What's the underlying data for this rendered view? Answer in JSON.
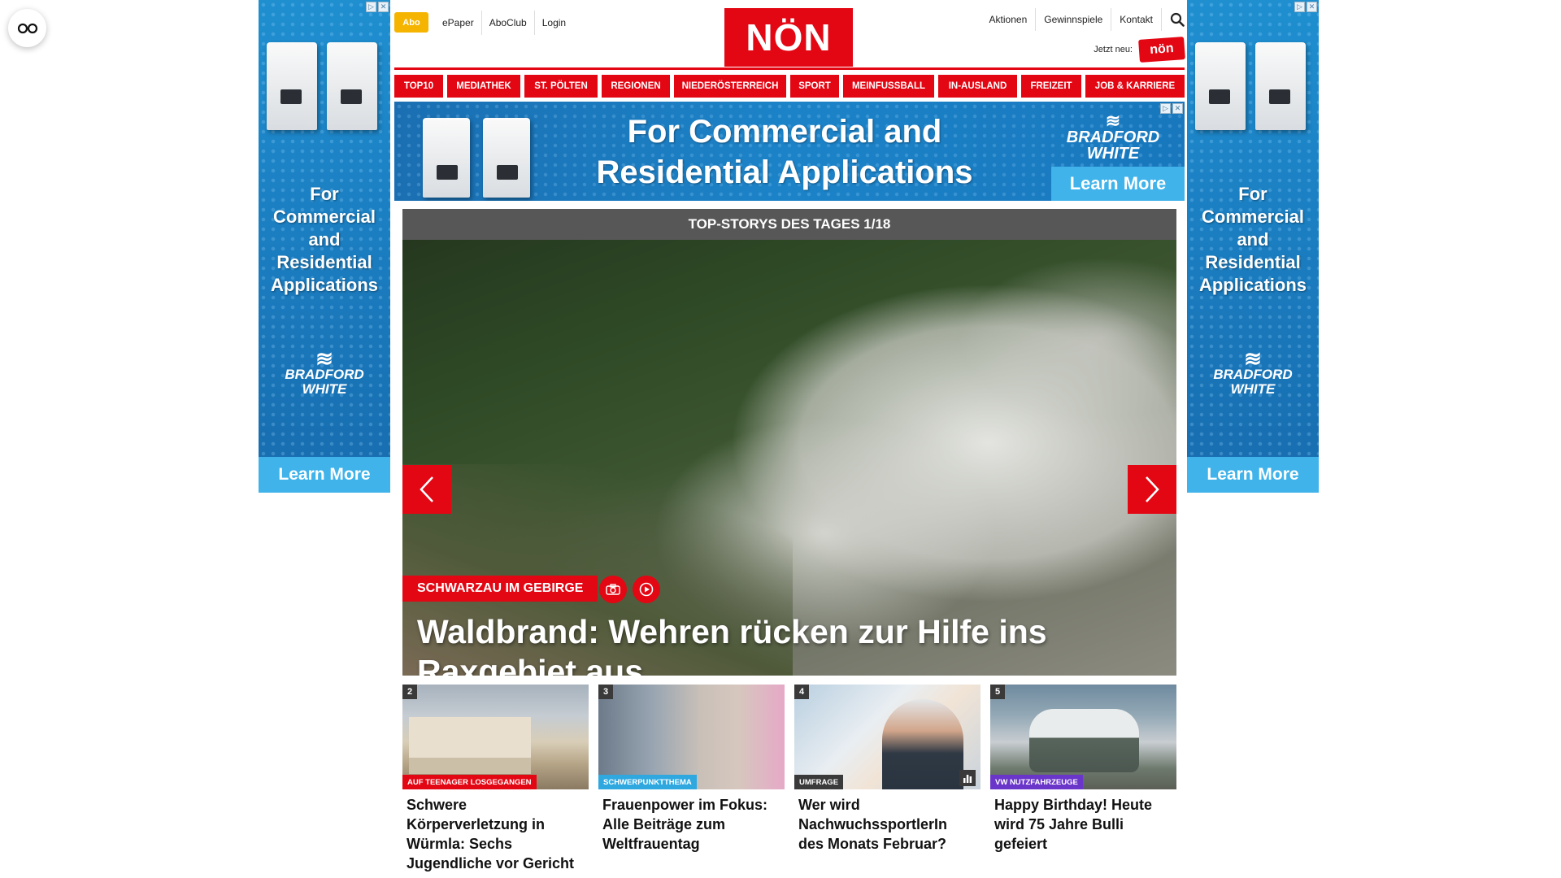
{
  "ads": {
    "ad_close_glyphs": [
      "▷",
      "✕"
    ],
    "sky_headline": "For Commercial and Residential Applications",
    "brand_line1": "BRADFORD",
    "brand_line2": "WHITE",
    "cta": "Learn More",
    "leader_headline_1": "For Commercial and",
    "leader_headline_2": "Residential Applications"
  },
  "header": {
    "abo": "Abo",
    "links_left": [
      "ePaper",
      "AboClub",
      "Login"
    ],
    "logo": "NÖN",
    "links_right": [
      "Aktionen",
      "Gewinnspiele",
      "Kontakt"
    ],
    "jetzt_label": "Jetzt neu:",
    "jetzt_badge": "nön",
    "accent": "#e30613"
  },
  "nav": [
    "TOP10",
    "MEDIATHEK",
    "ST. PÖLTEN",
    "REGIONEN",
    "NIEDERÖSTERREICH",
    "SPORT",
    "MEINFUSSBALL",
    "IN-AUSLAND",
    "FREIZEIT",
    "JOB & KARRIERE"
  ],
  "topstory": {
    "bar_label": "TOP-STORYS DES TAGES 1/18",
    "kicker": "SCHWARZAU IM GEBIRGE",
    "title": "Waldbrand: Wehren rücken zur Hilfe ins Raxgebiet aus"
  },
  "cards": [
    {
      "num": "2",
      "tag": "AUF TEENAGER LOSGEGANGEN",
      "tag_color": "#e30613",
      "title": "Schwere Körperverletzung in Würmla: Sechs Jugendliche vor Gericht"
    },
    {
      "num": "3",
      "tag": "SCHWERPUNKTTHEMA",
      "tag_color": "#2fa8e0",
      "title": "Frauenpower im Fokus: Alle Beiträge zum Weltfrauentag"
    },
    {
      "num": "4",
      "tag": "UMFRAGE",
      "tag_color": "#3a3a3a",
      "title": "Wer wird NachwuchssportlerIn des Monats Februar?"
    },
    {
      "num": "5",
      "tag": "VW NUTZFAHRZEUGE",
      "tag_color": "#6a35c9",
      "title": "Happy Birthday! Heute wird 75 Jahre Bulli gefeiert"
    }
  ]
}
